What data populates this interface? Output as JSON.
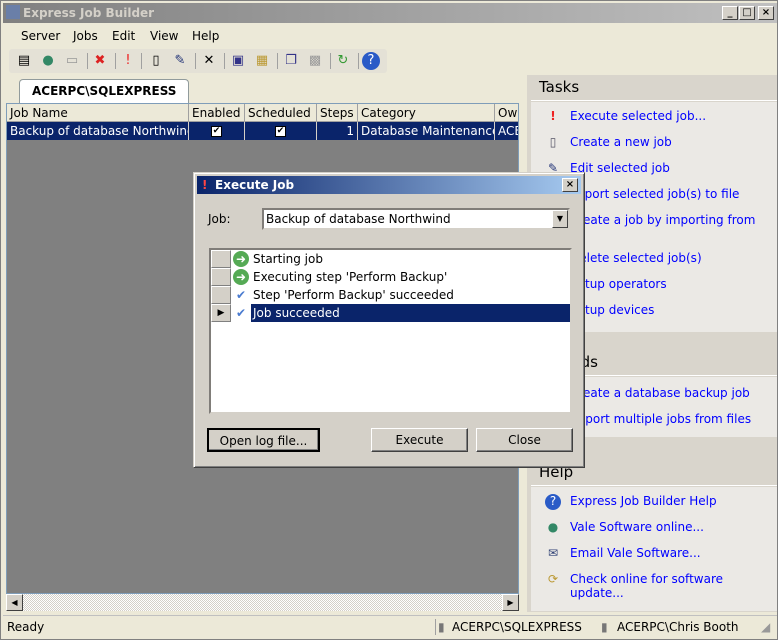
{
  "window": {
    "title": "Express Job Builder",
    "min": "_",
    "max": "□",
    "close": "×"
  },
  "menu": [
    "Server",
    "Jobs",
    "Edit",
    "View",
    "Help"
  ],
  "tab": "ACERPC\\SQLEXPRESS",
  "grid": {
    "columns": [
      "Job Name",
      "Enabled",
      "Scheduled",
      "Steps",
      "Category",
      "Owner"
    ],
    "rows": [
      {
        "name": "Backup of database Northwind",
        "enabled": "✔",
        "scheduled": "✔",
        "steps": "1",
        "category": "Database Maintenance",
        "owner": "ACERPC\\Chris Booth"
      }
    ]
  },
  "tasks": {
    "title": "Tasks",
    "items": [
      "Execute selected job...",
      "Create a new job",
      "Edit selected job",
      "Export selected job(s) to file",
      "Create a job by importing from a",
      "Delete selected job(s)",
      "Setup operators",
      "Setup devices"
    ]
  },
  "wizards": {
    "title": "Wizards",
    "items": [
      "Create a database backup job",
      "Import multiple jobs from files"
    ]
  },
  "help": {
    "title": "Help",
    "items": [
      "Express Job Builder Help",
      "Vale Software online...",
      "Email Vale Software...",
      "Check online for software update..."
    ]
  },
  "status": {
    "left": "Ready",
    "server": "ACERPC\\SQLEXPRESS",
    "user": "ACERPC\\Chris Booth"
  },
  "dialog": {
    "title": "Execute Job",
    "job_label": "Job:",
    "job_value": "Backup of database Northwind",
    "log": [
      {
        "icon": "arrow",
        "text": "Starting job"
      },
      {
        "icon": "arrow",
        "text": "Executing step 'Perform Backup'"
      },
      {
        "icon": "check",
        "text": "Step 'Perform Backup' succeeded"
      },
      {
        "icon": "check",
        "text": "Job succeeded",
        "selected": true
      }
    ],
    "open_log": "Open log file...",
    "execute": "Execute",
    "close": "Close"
  }
}
